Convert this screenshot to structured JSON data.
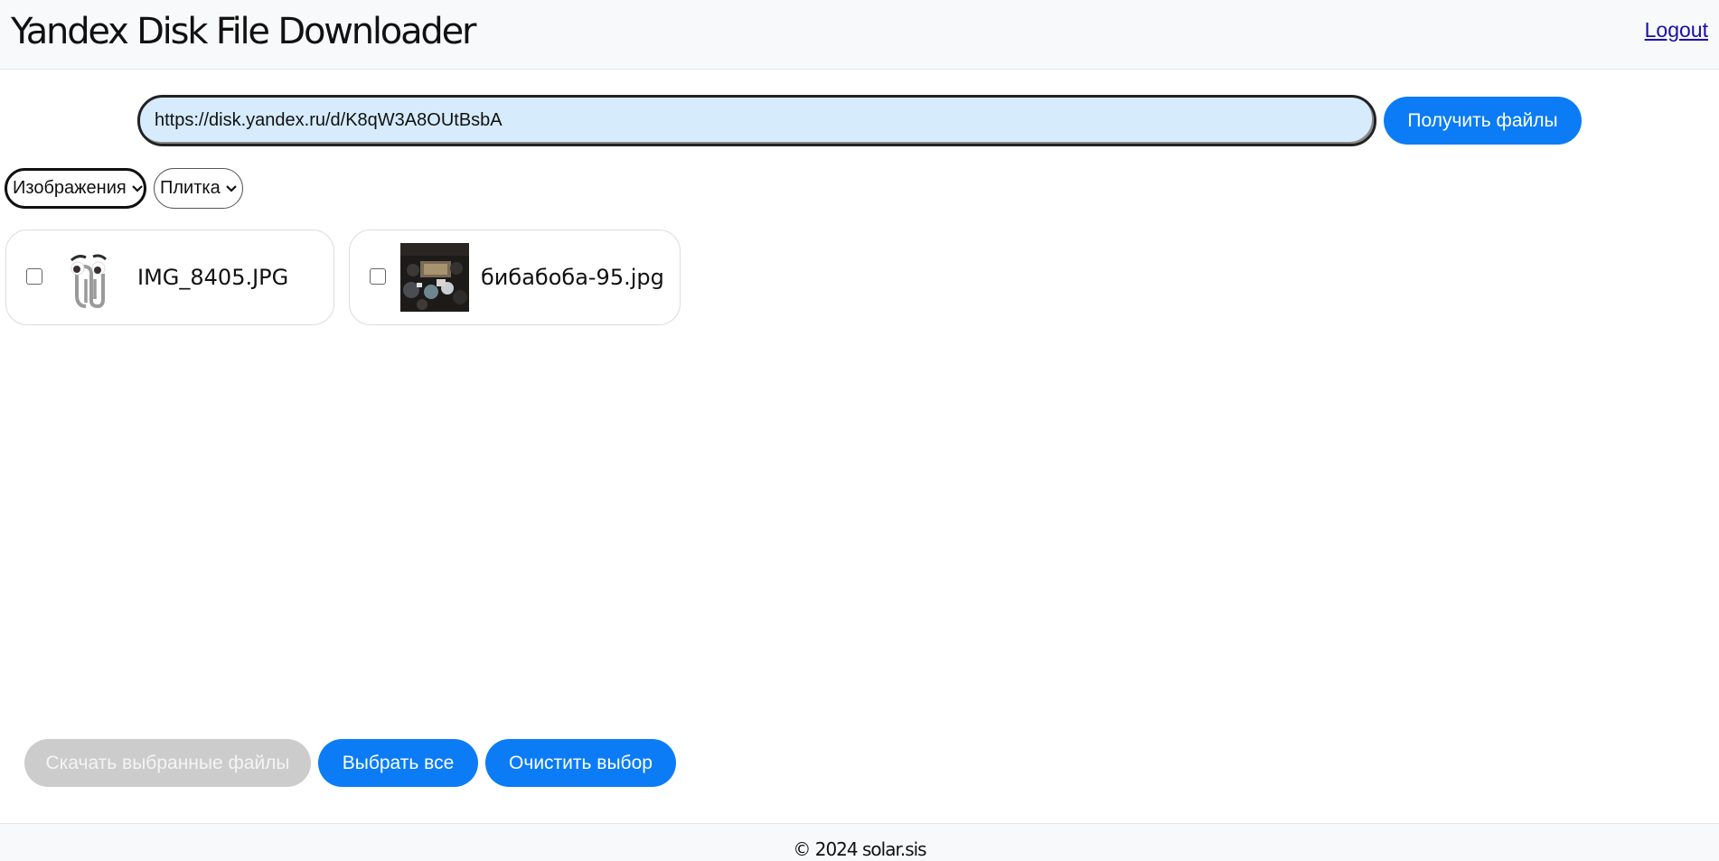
{
  "header": {
    "title": "Yandex Disk File Downloader",
    "logout_label": "Logout"
  },
  "search": {
    "url_value": "https://disk.yandex.ru/d/K8qW3A8OUtBsbA",
    "get_files_label": "Получить файлы"
  },
  "filters": {
    "type_selected": "Изображения",
    "view_selected": "Плитка"
  },
  "files": [
    {
      "name": "IMG_8405.JPG",
      "checked": false,
      "thumbnail": "paperclip-clippy-icon"
    },
    {
      "name": "бибабоба-95.jpg",
      "checked": false,
      "thumbnail": "photo-thumbnail"
    }
  ],
  "actions": {
    "download_selected_label": "Скачать выбранные файлы",
    "select_all_label": "Выбрать все",
    "clear_selection_label": "Очистить выбор"
  },
  "footer": {
    "copyright": "© 2024 solar.sis"
  },
  "colors": {
    "primary": "#0b7cf6",
    "disabled": "#cccccc",
    "input_bg": "#d6ebfc",
    "header_bg": "#f8f9fa"
  }
}
